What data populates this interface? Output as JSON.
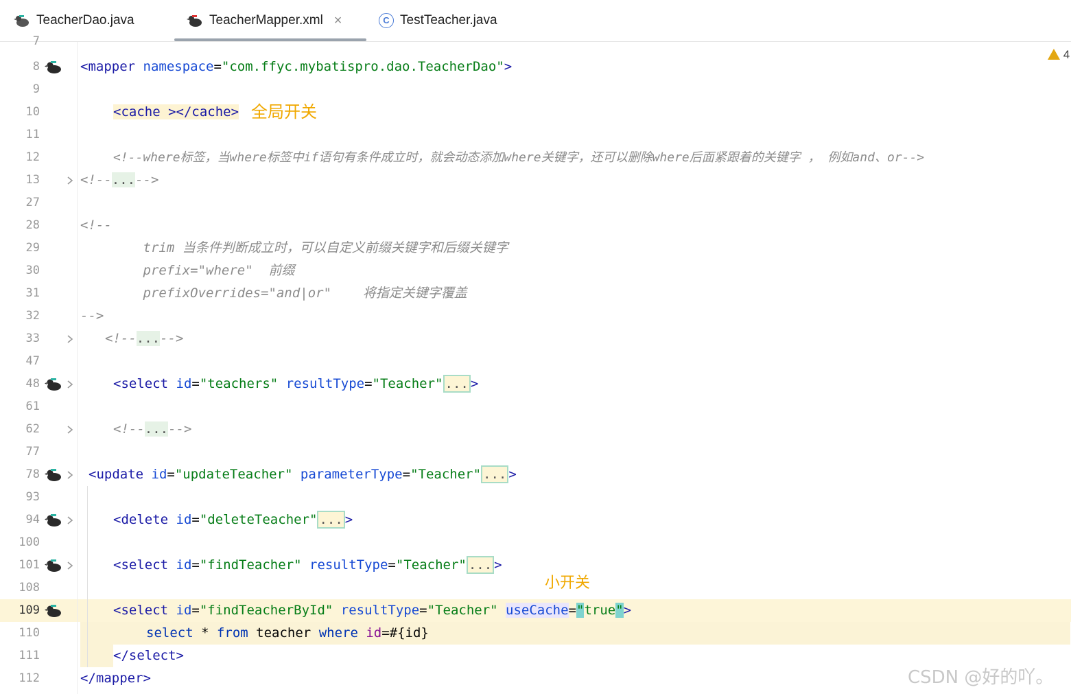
{
  "tabs": [
    {
      "label": "TeacherDao.java",
      "icon": "mybatis-bird-icon",
      "active": false
    },
    {
      "label": "TeacherMapper.xml",
      "icon": "mybatis-bird-icon",
      "active": true,
      "close": "×"
    },
    {
      "label": "TestTeacher.java",
      "icon": "class-icon",
      "icon_glyph": "C",
      "active": false
    }
  ],
  "inspection": {
    "warnings": "4"
  },
  "gutter": {
    "line_numbers": [
      "7",
      "8",
      "9",
      "10",
      "11",
      "12",
      "13",
      "27",
      "28",
      "29",
      "30",
      "31",
      "32",
      "33",
      "47",
      "48",
      "61",
      "62",
      "77",
      "78",
      "93",
      "94",
      "100",
      "101",
      "108",
      "109",
      "110",
      "111",
      "112"
    ]
  },
  "code": {
    "l8": {
      "tag_open": "<mapper",
      "attr": " namespace",
      "eq": "=",
      "val": "\"com.ffyc.mybatispro.dao.TeacherDao\"",
      "end": ">"
    },
    "l10": {
      "text": "<cache ></cache>"
    },
    "l12": "<!--where标签，当where标签中if语句有条件成立时，就会动态添加where关键字，还可以删除where后面紧跟着的关键字 ， 例如and、or-->",
    "l13": {
      "open": "<!--",
      "dots": "...",
      "close": "-->"
    },
    "l28": "<!--",
    "l29": "        trim 当条件判断成立时，可以自定义前缀关键字和后缀关键字",
    "l30": "        prefix=\"where\"  前缀",
    "l31": "        prefixOverrides=\"and|or\"    将指定关键字覆盖",
    "l32": "-->",
    "l33": {
      "open": "<!--",
      "dots": "...",
      "close": "-->"
    },
    "l48": {
      "tag": "<select",
      "a1": " id",
      "v1": "\"teachers\"",
      "a2": " resultType",
      "v2": "\"Teacher\"",
      "dots": "...",
      "end": ">"
    },
    "l62": {
      "open": "<!--",
      "dots": "...",
      "close": "-->"
    },
    "l78": {
      "tag": "<update",
      "a1": " id",
      "v1": "\"updateTeacher\"",
      "a2": " parameterType",
      "v2": "\"Teacher\"",
      "dots": "...",
      "end": ">"
    },
    "l94": {
      "tag": "<delete",
      "a1": " id",
      "v1": "\"deleteTeacher\"",
      "dots": "...",
      "end": ">"
    },
    "l101": {
      "tag": "<select",
      "a1": " id",
      "v1": "\"findTeacher\"",
      "a2": " resultType",
      "v2": "\"Teacher\"",
      "dots": "...",
      "end": ">"
    },
    "l109": {
      "tag": "<select",
      "a1": " id",
      "v1": "\"findTeacherById\"",
      "a2": " resultType",
      "v2": "\"Teacher\"",
      "a3": "useCache",
      "v3": "true",
      "end": ">"
    },
    "l110": {
      "kw1": "select",
      "star": " * ",
      "kw2": "from",
      "t": " teacher ",
      "kw3": "where",
      "id": " id",
      "rest": "=#{id}"
    },
    "l111": "</select>",
    "l112": "</mapper>"
  },
  "annotations": {
    "global_switch": "全局开关",
    "local_switch": "小开关"
  },
  "watermark": "CSDN @好的吖。",
  "colors": {
    "annotation": "#f0a800",
    "tag": "#1a1aa6",
    "attr": "#174ad4",
    "value": "#067d17",
    "comment": "#8c8c8c"
  }
}
